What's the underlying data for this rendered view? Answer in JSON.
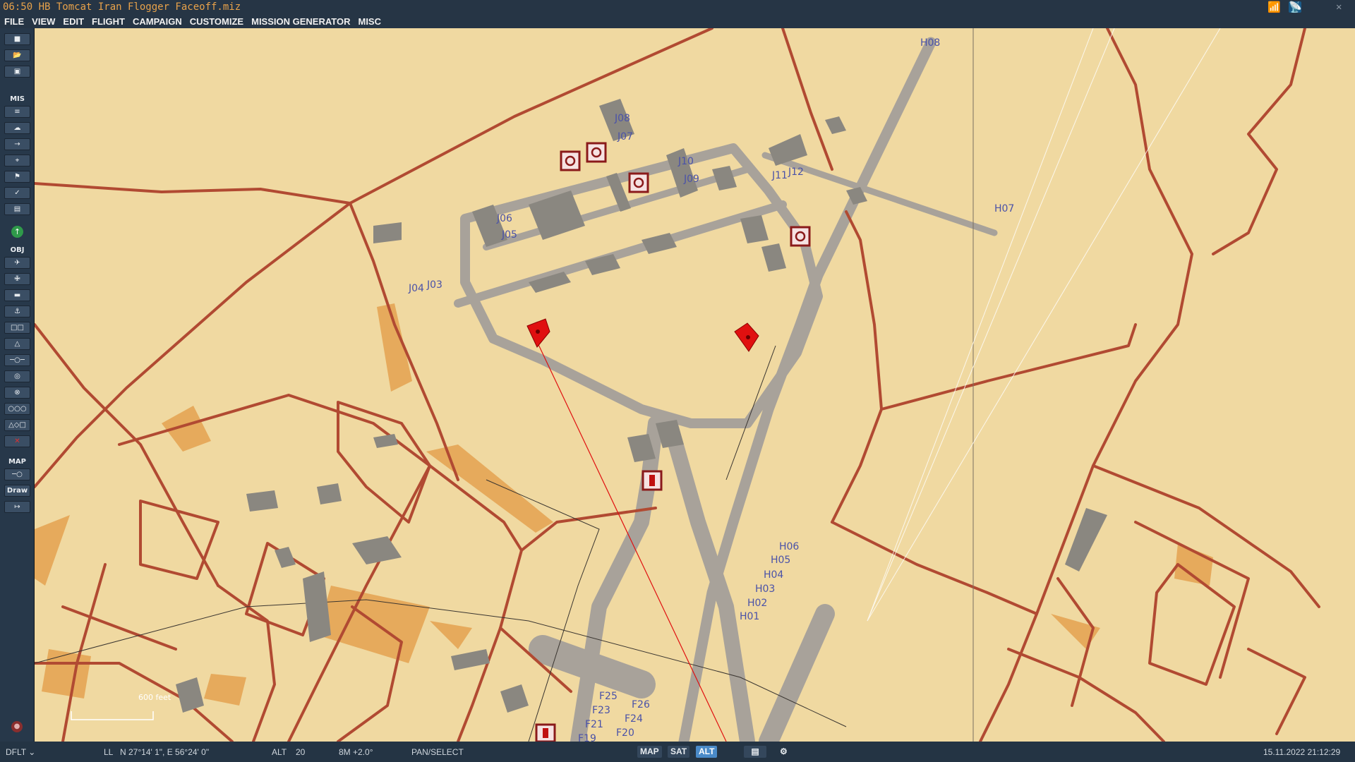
{
  "window": {
    "title": "06:50 HB Tomcat Iran Flogger Faceoff.miz"
  },
  "menu": [
    "FILE",
    "VIEW",
    "EDIT",
    "FLIGHT",
    "CAMPAIGN",
    "CUSTOMIZE",
    "MISSION GENERATOR",
    "MISC"
  ],
  "sidebar": {
    "mis_label": "MIS",
    "obj_label": "OBJ",
    "map_label": "MAP",
    "draw_label": "Draw"
  },
  "map": {
    "scale_label": "600 feet",
    "parking_labels": [
      "H08",
      "H07",
      "J08",
      "J07",
      "J10",
      "J09",
      "J11",
      "J12",
      "J06",
      "J05",
      "J04",
      "J03",
      "H06",
      "H05",
      "H04",
      "H03",
      "H02",
      "H01",
      "F25",
      "F26",
      "F23",
      "F24",
      "F21",
      "F20",
      "F19"
    ]
  },
  "status": {
    "profile": "DFLT",
    "coord_mode": "LL",
    "coords": "N 27°14' 1\", E 56°24' 0\"",
    "alt_label": "ALT",
    "alt_value": "20",
    "mag": "8M +2.0°",
    "mode": "PAN/SELECT",
    "map_buttons": [
      "MAP",
      "SAT",
      "ALT"
    ],
    "active_map_button": "ALT",
    "datetime": "15.11.2022 21:12:29"
  },
  "colors": {
    "terrain": "#f0d9a1",
    "road": "#b14a32",
    "taxiway": "#a8a29a",
    "building": "#8a8780",
    "marker_red": "#e01010",
    "label_blue": "#4a52a8",
    "chrome": "#263545",
    "accent_active": "#4a8ac8",
    "title_text": "#e8a24a"
  }
}
